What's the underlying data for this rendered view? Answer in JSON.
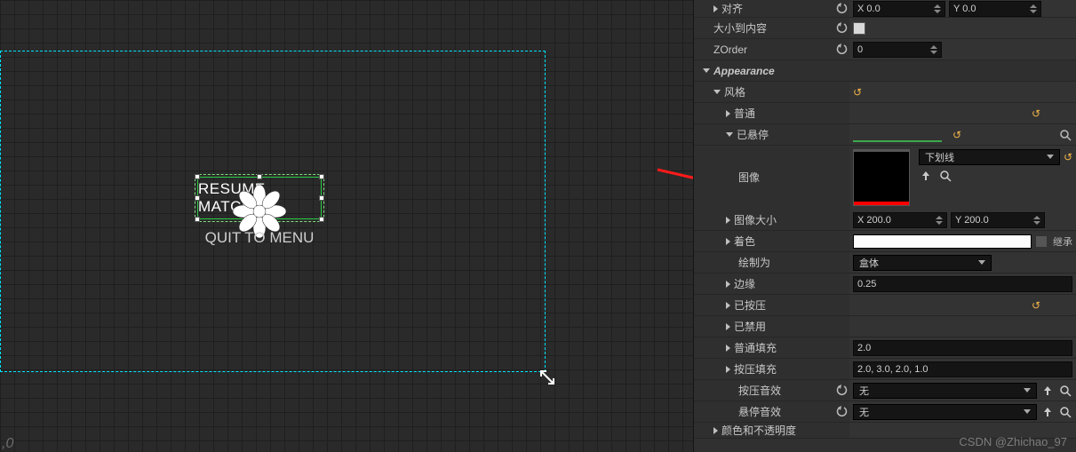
{
  "viewport": {
    "button_resume": "RESUME MATCH",
    "button_quit": "QUIT TO MENU",
    "coord_readout": ",0"
  },
  "panel": {
    "align_label": "对齐",
    "align_x": "X  0.0",
    "align_y": "Y  0.0",
    "size_to_content": "大小到内容",
    "zorder_label": "ZOrder",
    "zorder_value": "0",
    "appearance": "Appearance",
    "style": "风格",
    "normal": "普通",
    "hovered": "已悬停",
    "image_label": "图像",
    "image_draw_as": "下划线",
    "image_size": "图像大小",
    "image_x": "X  200.0",
    "image_y": "Y  200.0",
    "tint": "着色",
    "inherit": "继承",
    "draw_as": "绘制为",
    "draw_as_value": "盒体",
    "margin_label": "边缘",
    "margin_value": "0.25",
    "pressed": "已按压",
    "disabled": "已禁用",
    "normal_padding": "普通填充",
    "normal_padding_value": "2.0",
    "pressed_padding": "按压填充",
    "pressed_padding_value": "2.0, 3.0, 2.0, 1.0",
    "pressed_sound": "按压音效",
    "hover_sound": "悬停音效",
    "sound_none": "无",
    "color_opacity": "颜色和不透明度"
  },
  "watermark": "CSDN @Zhichao_97"
}
